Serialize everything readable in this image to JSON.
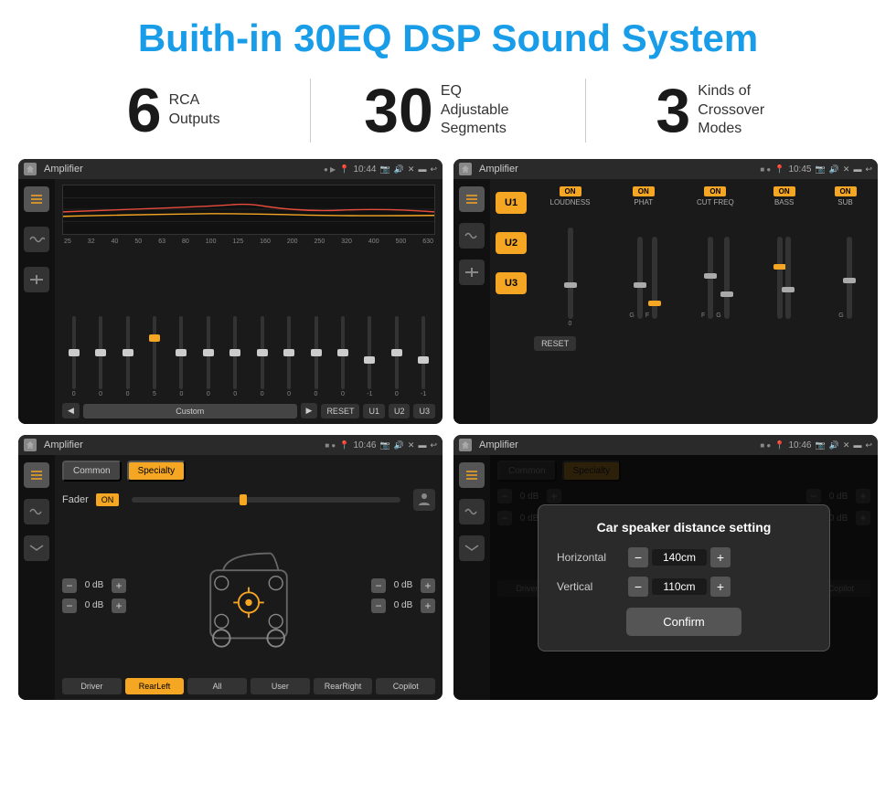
{
  "page": {
    "title": "Buith-in 30EQ DSP Sound System",
    "stats": [
      {
        "number": "6",
        "text": "RCA\nOutputs"
      },
      {
        "number": "30",
        "text": "EQ Adjustable\nSegments"
      },
      {
        "number": "3",
        "text": "Kinds of\nCrossover Modes"
      }
    ]
  },
  "screens": [
    {
      "id": "screen1",
      "app_name": "Amplifier",
      "time": "10:44",
      "type": "eq",
      "eq_bands": [
        "25",
        "32",
        "40",
        "50",
        "63",
        "80",
        "100",
        "125",
        "160",
        "200",
        "250",
        "320",
        "400",
        "500",
        "630"
      ],
      "eq_values": [
        "0",
        "0",
        "0",
        "5",
        "0",
        "0",
        "0",
        "0",
        "0",
        "0",
        "0",
        "-1",
        "0",
        "-1"
      ],
      "preset": "Custom",
      "buttons": [
        "◀",
        "Custom",
        "▶",
        "RESET",
        "U1",
        "U2",
        "U3"
      ]
    },
    {
      "id": "screen2",
      "app_name": "Amplifier",
      "time": "10:45",
      "type": "crossover",
      "u_buttons": [
        "U1",
        "U2",
        "U3"
      ],
      "params": [
        "LOUDNESS",
        "PHAT",
        "CUT FREQ",
        "BASS",
        "SUB"
      ],
      "all_on": true
    },
    {
      "id": "screen3",
      "app_name": "Amplifier",
      "time": "10:46",
      "type": "fader",
      "tabs": [
        "Common",
        "Specialty"
      ],
      "fader_label": "Fader",
      "fader_on": true,
      "db_values": [
        "0 dB",
        "0 dB",
        "0 dB",
        "0 dB"
      ],
      "buttons": [
        "Driver",
        "RearLeft",
        "All",
        "User",
        "RearRight",
        "Copilot"
      ]
    },
    {
      "id": "screen4",
      "app_name": "Amplifier",
      "time": "10:46",
      "type": "distance",
      "tabs": [
        "Common",
        "Specialty"
      ],
      "dialog": {
        "title": "Car speaker distance setting",
        "horizontal_label": "Horizontal",
        "horizontal_value": "140cm",
        "vertical_label": "Vertical",
        "vertical_value": "110cm",
        "confirm_label": "Confirm"
      }
    }
  ]
}
